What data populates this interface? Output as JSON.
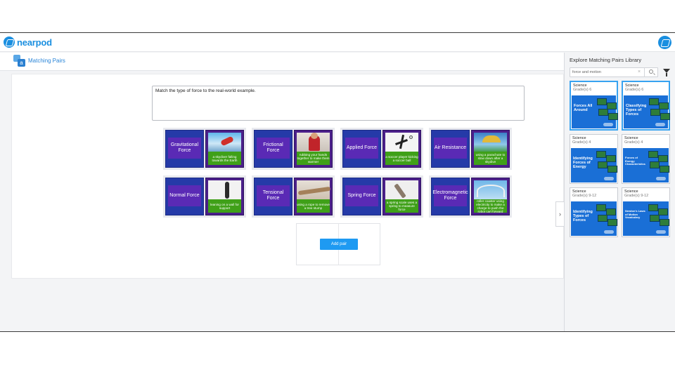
{
  "app": {
    "brand": "nearpod",
    "activity_title": "Matching Pairs",
    "mp_icon_letter": "a"
  },
  "colors": {
    "accent": "#1a8fe0",
    "left_card": "#253aa8",
    "right_card": "#4b1f8a",
    "caption": "#3fa018",
    "button": "#1e9af2"
  },
  "editor": {
    "instructions": "Match the type of force to the real-world example.",
    "add_pair_label": "Add pair"
  },
  "pairs": [
    {
      "term": "Gravitational Force",
      "caption": "a skydiver falling towards the Earth"
    },
    {
      "term": "Frictional Force",
      "caption": "rubbing your hands together to make them warmer"
    },
    {
      "term": "Applied Force",
      "caption": "a soccer player kicking a soccer ball"
    },
    {
      "term": "Air Resistance",
      "caption": "using a parachute to slow down after a skydive"
    },
    {
      "term": "Normal Force",
      "caption": "leaning on a wall for support"
    },
    {
      "term": "Tensional Force",
      "caption": "using a rope to remove a tree stump"
    },
    {
      "term": "Spring Force",
      "caption": "a spring scale uses a spring to measure force"
    },
    {
      "term": "Electromagnetic Force",
      "caption": "roller coaster using electricity to make a charge to push the robot cart forward"
    }
  ],
  "sidebar": {
    "title": "Explore Matching Pairs Library",
    "search_value": "force and motion",
    "clear_glyph": "×",
    "collapse_glyph": "›",
    "library": [
      {
        "subject": "Science",
        "grade": "Grade(s) 6",
        "title": "Forces All Around"
      },
      {
        "subject": "Science",
        "grade": "Grade(s) 6",
        "title": "Classifying Types of Forces"
      },
      {
        "subject": "Science",
        "grade": "Grade(s) 4",
        "title": "Identifying Forces of Energy"
      },
      {
        "subject": "Science",
        "grade": "Grade(s) 4",
        "title": "Forces of Energy Characteristics"
      },
      {
        "subject": "Science",
        "grade": "Grade(s) 9-12",
        "title": "Identifying Types of Forces"
      },
      {
        "subject": "Science",
        "grade": "Grade(s) 9-12",
        "title": "Newton's Laws of Motion Vocabulary"
      }
    ]
  }
}
